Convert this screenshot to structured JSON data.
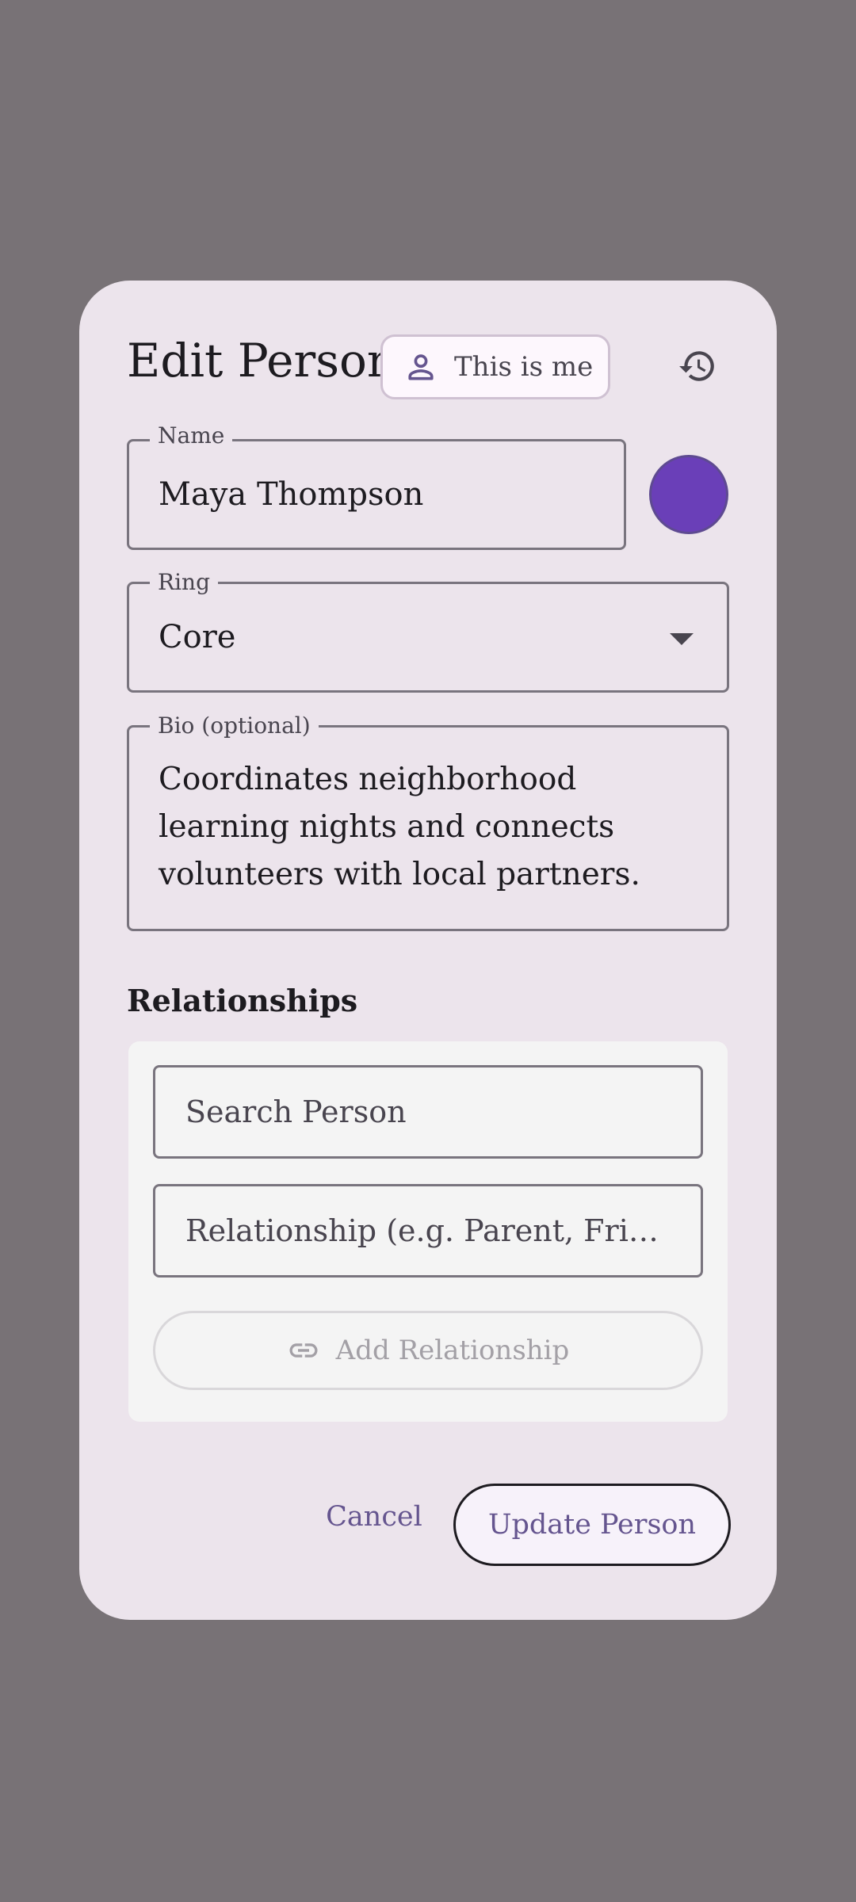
{
  "dialog": {
    "title": "Edit Person",
    "me_chip": {
      "label": "This is me",
      "icon": "person-icon"
    },
    "history_icon": "history-icon"
  },
  "form": {
    "name": {
      "label": "Name",
      "value": "Maya Thompson"
    },
    "color": {
      "value": "#6A3FB8"
    },
    "ring": {
      "label": "Ring",
      "value": "Core"
    },
    "bio": {
      "label": "Bio (optional)",
      "value": "Coordinates neighborhood learning nights and connects volunteers with local partners."
    }
  },
  "relationships": {
    "heading": "Relationships",
    "search_placeholder": "Search Person",
    "relationship_placeholder": "Relationship (e.g. Parent, Friend)",
    "add_label": "Add Relationship",
    "add_icon": "link-icon"
  },
  "actions": {
    "cancel_label": "Cancel",
    "update_label": "Update Person"
  },
  "colors": {
    "scrim": "#787276",
    "surface": "#ECE4EC",
    "primary": "#65558F",
    "on_surface": "#1D1B20"
  }
}
